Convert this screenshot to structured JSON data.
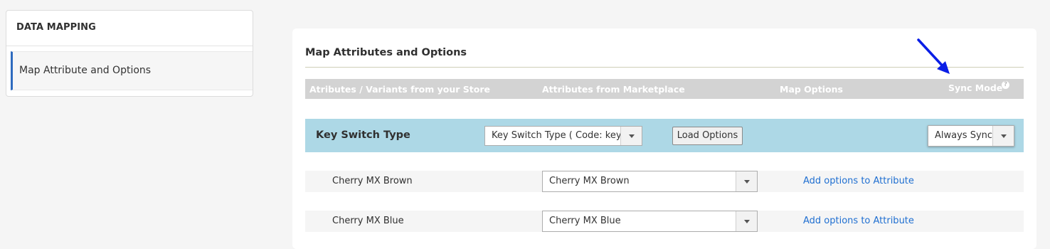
{
  "sidebar": {
    "title": "DATA MAPPING",
    "items": [
      {
        "label": "Map Attribute and Options"
      }
    ]
  },
  "main": {
    "title": "Map Attributes and Options",
    "header": {
      "store": "Atributes / Variants from your Store",
      "marketplace": "Attributes from Marketplace",
      "map_options": "Map Options",
      "sync_mode": "Sync Mode",
      "help_glyph": "?"
    },
    "attribute": {
      "name": "Key Switch Type",
      "marketplace_select": "Key Switch Type ( Code: key_s",
      "load_button": "Load Options",
      "sync_select": "Always Sync"
    },
    "options": [
      {
        "store_value": "Cherry MX Brown",
        "marketplace_value": "Cherry MX Brown",
        "link": "Add options to Attribute"
      },
      {
        "store_value": "Cherry MX Blue",
        "marketplace_value": "Cherry MX Blue",
        "link": "Add options to Attribute"
      }
    ]
  },
  "annotation": {
    "arrow_color": "#0a1ee6",
    "icon": "arrow-down-right-icon"
  },
  "colors": {
    "attribute_row": "#add8e6",
    "header_bar": "#d3d3d3",
    "link": "#1f6fd1",
    "active_border": "#2e6bbf"
  }
}
